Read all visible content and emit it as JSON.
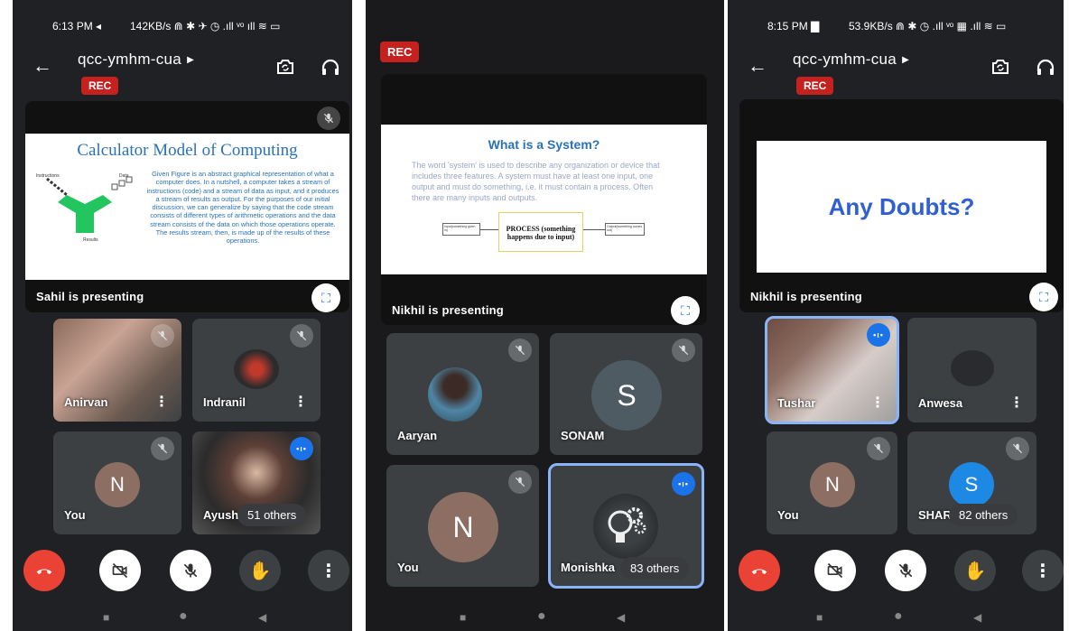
{
  "colors": {
    "accent": "#1a73e8",
    "rec": "#c5221f",
    "end_call": "#ea4335",
    "tile": "#3c4043",
    "background": "#202124"
  },
  "icons": {
    "back": "arrow-left-icon",
    "switch_camera": "camera-switch-icon",
    "audio": "headphones-icon",
    "muted": "mic-off-icon",
    "fullscreen": "fullscreen-icon",
    "end_call": "phone-hangup-icon",
    "camera_off": "camera-off-icon",
    "raise_hand": "hand-icon",
    "more": "more-vertical-icon"
  },
  "left": {
    "status": {
      "time": "6:13 PM ◂",
      "net": "142KB/s ⋒ ✱ ✈ ◷ .ıll ᵛᵒ ıll ≋ ▭"
    },
    "meeting_code": "qcc-ymhm-cua",
    "rec_label": "REC",
    "presenter": "Sahil is presenting",
    "slide": {
      "title": "Calculator Model of Computing",
      "label_instructions": "Instructions",
      "label_data": "Data",
      "label_results": "Results",
      "body": "Given Figure is an abstract graphical representation of what a computer does. In a nutshell, a computer takes a stream of instructions (code) and a stream of data as input, and it produces a stream of results as output. For the purposes of our initial discussion, we can generalize by saying that the code stream consists of different types of arithmetic operations and the data stream consists of the data on which those operations operate. The results stream, then, is made up of the results of these operations."
    },
    "tiles": [
      {
        "name": "Anirvan"
      },
      {
        "name": "Indranil"
      },
      {
        "name": "You",
        "initial": "N"
      },
      {
        "name": "Ayush",
        "others": "51 others"
      }
    ]
  },
  "middle": {
    "rec_label": "REC",
    "presenter": "Nikhil is presenting",
    "slide": {
      "title": "What is a System?",
      "body": "The word 'system' is used to describe any organization or device that includes three features. A system must have at least one input, one output and must do something, i.e. it must contain a process. Often there are many inputs and outputs.",
      "input_label": "Input(something given in)",
      "process_label": "PROCESS (something happens due to input)",
      "output_label": "Output(something comes out)"
    },
    "tiles": [
      {
        "name": "Aaryan"
      },
      {
        "name": "SONAM",
        "initial": "S"
      },
      {
        "name": "You",
        "initial": "N"
      },
      {
        "name": "Monishka",
        "others": "83 others"
      }
    ]
  },
  "right": {
    "status": {
      "time": "8:15 PM ▇",
      "net": "53.9KB/s ⋒ ✱ ◷ .ıll ᵛᵒ ▦ .ıll ≋ ▭"
    },
    "meeting_code": "qcc-ymhm-cua",
    "rec_label": "REC",
    "presenter": "Nikhil is presenting",
    "slide": {
      "title": "Any Doubts?"
    },
    "tiles": [
      {
        "name": "Tushar"
      },
      {
        "name": "Anwesa"
      },
      {
        "name": "You",
        "initial": "N"
      },
      {
        "name": "SHAR",
        "initial": "S",
        "others": "82 others"
      }
    ]
  },
  "nav_buttons": {
    "recents": "■",
    "home": "●",
    "back": "◀"
  }
}
